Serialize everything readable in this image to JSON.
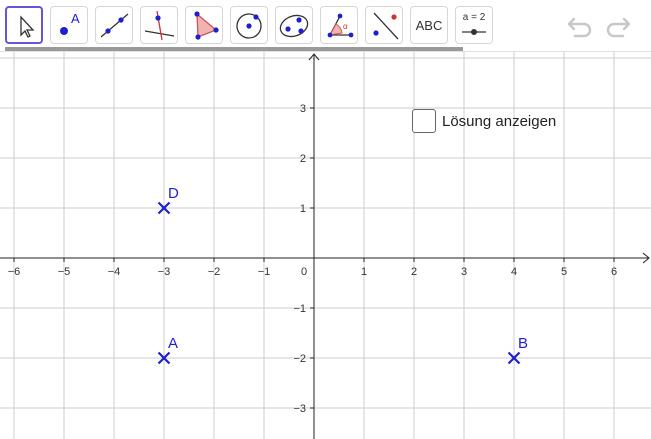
{
  "toolbar": {
    "tools": [
      {
        "name": "move",
        "selected": true
      },
      {
        "name": "point",
        "label": "A"
      },
      {
        "name": "line"
      },
      {
        "name": "perpendicular-line"
      },
      {
        "name": "polygon"
      },
      {
        "name": "circle"
      },
      {
        "name": "conic"
      },
      {
        "name": "angle"
      },
      {
        "name": "reflect"
      },
      {
        "name": "text",
        "label": "ABC"
      },
      {
        "name": "slider",
        "label": "a = 2"
      }
    ]
  },
  "graphics": {
    "x_ticks": [
      "−6",
      "−5",
      "−4",
      "−3",
      "−2",
      "−1",
      "0",
      "1",
      "2",
      "3",
      "4",
      "5",
      "6"
    ],
    "y_ticks_pos": [
      "3",
      "2",
      "1"
    ],
    "y_ticks_neg": [
      "−1",
      "−2",
      "−3"
    ],
    "points": [
      {
        "label": "D",
        "x": -3,
        "y": 1
      },
      {
        "label": "A",
        "x": -3,
        "y": -2
      },
      {
        "label": "B",
        "x": 4,
        "y": -2
      }
    ],
    "point_color": "#1f1fd0",
    "grid_color": "#cccccc"
  },
  "checkbox": {
    "label": "Lösung anzeigen",
    "checked": false
  }
}
